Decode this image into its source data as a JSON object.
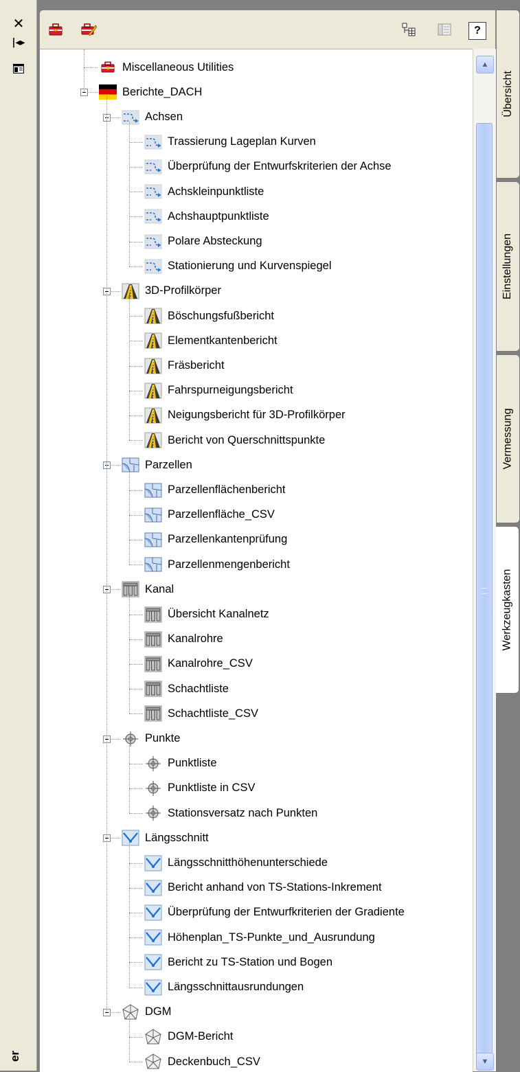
{
  "tree": [
    {
      "label": "Miscellaneous Utilities",
      "icon": "toolbox-icon",
      "level": 0
    },
    {
      "label": "Berichte_DACH",
      "icon": "german-flag-icon",
      "level": 0,
      "expanded": true
    },
    {
      "label": "Achsen",
      "icon": "alignment-icon",
      "level": 1,
      "expanded": true
    },
    {
      "label": "Trassierung Lageplan Kurven",
      "icon": "alignment-icon",
      "level": 2
    },
    {
      "label": "Überprüfung der Entwurfskriterien der Achse",
      "icon": "alignment-icon",
      "level": 2
    },
    {
      "label": "Achskleinpunktliste",
      "icon": "alignment-icon",
      "level": 2
    },
    {
      "label": "Achshauptpunktliste",
      "icon": "alignment-icon",
      "level": 2
    },
    {
      "label": "Polare Absteckung",
      "icon": "alignment-icon",
      "level": 2
    },
    {
      "label": "Stationierung und Kurvenspiegel",
      "icon": "alignment-icon",
      "level": 2,
      "last": true
    },
    {
      "label": "3D-Profilkörper",
      "icon": "corridor-icon",
      "level": 1,
      "expanded": true
    },
    {
      "label": "Böschungsfußbericht",
      "icon": "corridor-icon",
      "level": 2
    },
    {
      "label": "Elementkantenbericht",
      "icon": "corridor-icon",
      "level": 2
    },
    {
      "label": "Fräsbericht",
      "icon": "corridor-icon",
      "level": 2
    },
    {
      "label": "Fahrspurneigungsbericht",
      "icon": "corridor-icon",
      "level": 2
    },
    {
      "label": "Neigungsbericht für 3D-Profilkörper",
      "icon": "corridor-icon",
      "level": 2
    },
    {
      "label": "Bericht von Querschnittspunkte",
      "icon": "corridor-icon",
      "level": 2,
      "last": true
    },
    {
      "label": "Parzellen",
      "icon": "parcel-icon",
      "level": 1,
      "expanded": true
    },
    {
      "label": "Parzellenflächenbericht",
      "icon": "parcel-icon",
      "level": 2
    },
    {
      "label": "Parzellenfläche_CSV",
      "icon": "parcel-icon",
      "level": 2
    },
    {
      "label": "Parzellenkantenprüfung",
      "icon": "parcel-icon",
      "level": 2
    },
    {
      "label": "Parzellenmengenbericht",
      "icon": "parcel-icon",
      "level": 2,
      "last": true
    },
    {
      "label": "Kanal",
      "icon": "pipe-network-icon",
      "level": 1,
      "expanded": true
    },
    {
      "label": "Übersicht Kanalnetz",
      "icon": "pipe-network-icon",
      "level": 2
    },
    {
      "label": "Kanalrohre",
      "icon": "pipe-network-icon",
      "level": 2
    },
    {
      "label": "Kanalrohre_CSV",
      "icon": "pipe-network-icon",
      "level": 2
    },
    {
      "label": "Schachtliste",
      "icon": "pipe-network-icon",
      "level": 2
    },
    {
      "label": "Schachtliste_CSV",
      "icon": "pipe-network-icon",
      "level": 2,
      "last": true
    },
    {
      "label": "Punkte",
      "icon": "point-icon",
      "level": 1,
      "expanded": true
    },
    {
      "label": "Punktliste",
      "icon": "point-icon",
      "level": 2
    },
    {
      "label": "Punktliste in CSV",
      "icon": "point-icon",
      "level": 2
    },
    {
      "label": "Stationsversatz nach Punkten",
      "icon": "point-icon",
      "level": 2,
      "last": true
    },
    {
      "label": "Längsschnitt",
      "icon": "profile-icon",
      "level": 1,
      "expanded": true
    },
    {
      "label": "Längsschnitthöhenunterschiede",
      "icon": "profile-icon",
      "level": 2
    },
    {
      "label": "Bericht anhand von TS-Stations-Inkrement",
      "icon": "profile-icon",
      "level": 2
    },
    {
      "label": "Überprüfung der Entwurfkriterien der Gradiente",
      "icon": "profile-icon",
      "level": 2
    },
    {
      "label": "Höhenplan_TS-Punkte_und_Ausrundung",
      "icon": "profile-icon",
      "level": 2
    },
    {
      "label": "Bericht zu TS-Station und Bogen",
      "icon": "profile-icon",
      "level": 2
    },
    {
      "label": "Längsschnittausrundungen",
      "icon": "profile-icon",
      "level": 2,
      "last": true
    },
    {
      "label": "DGM",
      "icon": "surface-icon",
      "level": 1,
      "expanded": true
    },
    {
      "label": "DGM-Bericht",
      "icon": "surface-icon",
      "level": 2
    },
    {
      "label": "Deckenbuch_CSV",
      "icon": "surface-icon",
      "level": 2,
      "last": true
    }
  ],
  "tabs": [
    {
      "label": "Übersicht",
      "active": false
    },
    {
      "label": "Einstellungen",
      "active": false
    },
    {
      "label": "Vermessung",
      "active": false
    },
    {
      "label": "Werkzeugkasten",
      "active": true
    }
  ],
  "strip": {
    "title_fragment": "er"
  },
  "toolbar": {
    "help_label": "?"
  }
}
